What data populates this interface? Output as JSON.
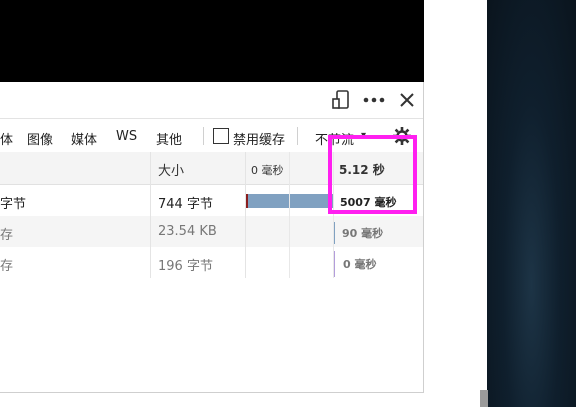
{
  "toolbar": {
    "filters": [
      "体",
      "图像",
      "媒体",
      "WS",
      "其他"
    ],
    "disable_cache": "禁用缓存",
    "throttle": "不节流",
    "icons": [
      "device-emulation-icon",
      "more-icon",
      "close-icon",
      "settings-gear-icon"
    ]
  },
  "table": {
    "columns": {
      "size": "大小",
      "timeline_start": "0 毫秒",
      "timeline_total": "5.12 秒"
    },
    "rows": [
      {
        "type": "字节",
        "size": "744 字节",
        "time": "5007 毫秒",
        "bar_fraction": 0.98
      },
      {
        "type": "存",
        "size": "23.54 KB",
        "time": "90 毫秒",
        "bar_fraction": 0.02
      },
      {
        "type": "存",
        "size": "196 字节",
        "time": "0 毫秒",
        "bar_fraction": 0.0
      }
    ]
  },
  "highlight_color": "#ff1ff0",
  "bar_color": "#80a1c1"
}
